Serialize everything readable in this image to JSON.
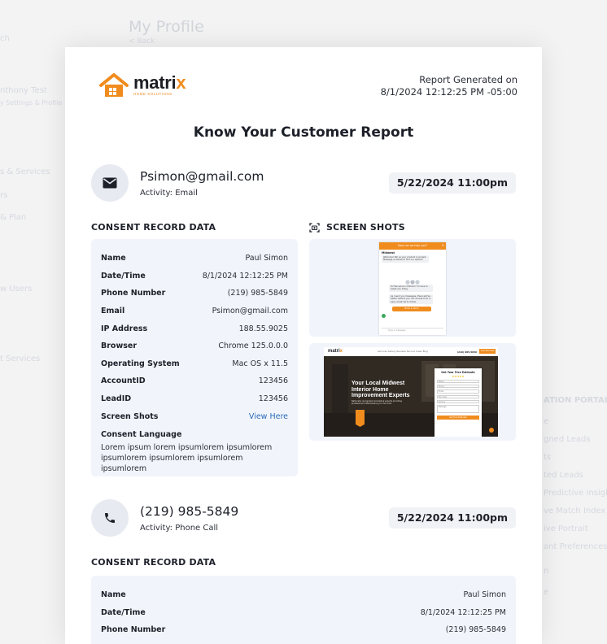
{
  "background_app": {
    "title": "My Profile",
    "subtitle": "< Back",
    "left_items": [
      "ch",
      "nthony Test",
      "y Settings & Profile",
      "s & Services",
      "rs",
      "& Plan",
      "w Users",
      "t Services"
    ],
    "right_items": [
      "ATION PORTAL",
      "e",
      "gned Leads",
      "ts",
      "ted Leads",
      "Predictive Insight",
      "ve Match Index",
      "ive Portrait",
      "ant Preferences",
      "n",
      "e"
    ]
  },
  "report": {
    "logo": {
      "word_main": "matri",
      "word_accent": "x",
      "tagline": "HOME SOLUTIONS"
    },
    "generated_label": "Report Generated on",
    "generated_value": "8/1/2024 12:12:25 PM -05:00",
    "title": "Know Your Customer Report",
    "screens_label": "SCREEN SHOTS",
    "consent_label": "CONSENT RECORD DATA",
    "records": [
      {
        "contact": "Psimon@gmail.com",
        "activity": "Activity: Email",
        "date": "5/22/2024 11:00pm",
        "icon": "envelope-icon",
        "fields": [
          {
            "key": "Name",
            "value": "Paul Simon"
          },
          {
            "key": "Date/Time",
            "value": "8/1/2024 12:12:25 PM"
          },
          {
            "key": "Phone Number",
            "value": "(219) 985-5849"
          },
          {
            "key": "Email",
            "value": "Psimon@gmail.com"
          },
          {
            "key": "IP Address",
            "value": "188.55.9025"
          },
          {
            "key": "Browser",
            "value": "Chrome 125.0.0.0"
          },
          {
            "key": "Operating System",
            "value": "Mac OS x 11.5"
          },
          {
            "key": "AccountID",
            "value": "123456"
          },
          {
            "key": "LeadID",
            "value": "123456"
          },
          {
            "key": "Screen Shots",
            "value": "View Here"
          }
        ],
        "consent_language_label": "Consent Language",
        "consent_language": "Lorem ipsum lorem ipsumlorem ipsumlorem ipsumlorem ipsumlorem ipsumlorem ipsumlorem"
      },
      {
        "contact": "(219) 985-5849",
        "activity": "Activity: Phone Call",
        "date": "5/22/2024 11:00pm",
        "icon": "phone-icon",
        "fields": [
          {
            "key": "Name",
            "value": "Paul Simon"
          },
          {
            "key": "Date/Time",
            "value": "8/1/2024 12:12:25 PM"
          },
          {
            "key": "Phone Number",
            "value": "(219) 985-5849"
          }
        ]
      }
    ]
  },
  "chat_mockup": {
    "header": "How can we help you?",
    "greeting_name": "Midwest",
    "greeting": "Welcome! Tell us your product or project. Message us below to find our options.",
    "message_1": "Hi! We serve in Elkhart! I'm here to assist you today.",
    "message_2": "As I send you messages, there will be better options you can choose from in easy. Great list to follow.",
    "cta": "Book a call ⊕",
    "input_placeholder": "Type a message..."
  },
  "site_mockup": {
    "logo_main": "matri",
    "logo_accent": "x",
    "nav_links": "Services   Gallery   Reviews   Service Areas   Blog",
    "phone": "(219) 985-5849",
    "cta": "Free Estimate",
    "headline": "Your Local Midwest Interior Home Improvement Experts",
    "body": "Nationally recognized remodeling experts providing professional craftsmanship you can trust.",
    "form_title": "Get Your Free Estimate",
    "form_stars": "★★★★★",
    "form_fields": [
      "Name",
      "Phone",
      "Email",
      "Zip Code",
      "Service",
      "Message"
    ],
    "form_button": "Get Free Estimate"
  },
  "colors": {
    "brand": "#f08c1e",
    "link": "#2a6ab8",
    "panel": "#f1f5fb",
    "avatar": "#e7eaf1"
  }
}
